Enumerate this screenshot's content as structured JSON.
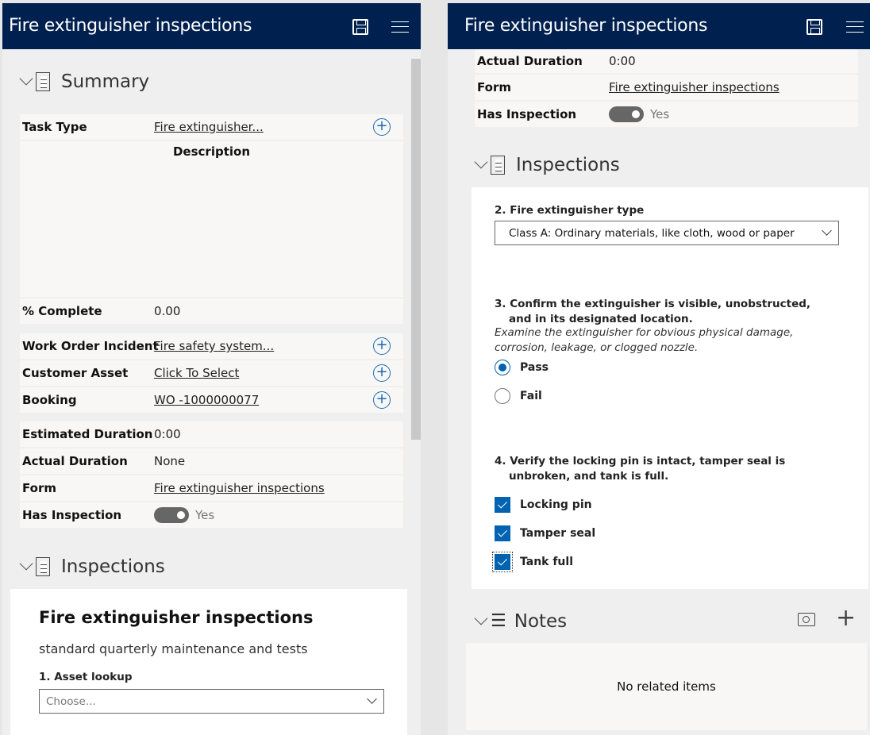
{
  "app_title": "Fire extinguisher inspections",
  "left": {
    "summary_title": "Summary",
    "task_type": {
      "label": "Task Type",
      "value": "Fire extinguisher..."
    },
    "description_label": "Description",
    "percent_complete": {
      "label": "% Complete",
      "value": "0.00"
    },
    "work_order_incident": {
      "label": "Work Order Incident",
      "value": "Fire safety system..."
    },
    "customer_asset": {
      "label": "Customer Asset",
      "value": "Click To Select"
    },
    "booking": {
      "label": "Booking",
      "value": "WO -1000000077"
    },
    "estimated_duration": {
      "label": "Estimated Duration",
      "value": "0:00"
    },
    "actual_duration": {
      "label": "Actual Duration",
      "value": "None"
    },
    "form": {
      "label": "Form",
      "value": "Fire extinguisher inspections"
    },
    "has_inspection": {
      "label": "Has Inspection",
      "value": "Yes"
    },
    "inspections_title": "Inspections",
    "form_title": "Fire extinguisher inspections",
    "form_subtitle": "standard quarterly maintenance and tests",
    "q1": "1.  Asset lookup",
    "q1_placeholder": "Choose..."
  },
  "right": {
    "actual_duration": {
      "label": "Actual Duration",
      "value": "0:00"
    },
    "form": {
      "label": "Form",
      "value": "Fire extinguisher inspections"
    },
    "has_inspection": {
      "label": "Has Inspection",
      "value": "Yes"
    },
    "inspections_title": "Inspections",
    "q2": "2.  Fire extinguisher type",
    "q2_value": "Class A: Ordinary materials, like cloth, wood or paper",
    "q3": "3.  Confirm the extinguisher is visible, unobstructed, and in its designated location.",
    "q3_desc": "Examine the extinguisher for obvious physical damage, corrosion, leakage, or clogged nozzle.",
    "q3_options": [
      "Pass",
      "Fail"
    ],
    "q4": "4.  Verify the locking pin is intact, tamper seal is unbroken, and tank is full.",
    "q4_options": [
      "Locking pin",
      "Tamper seal",
      "Tank full"
    ],
    "notes_title": "Notes",
    "notes_empty": "No related items"
  }
}
